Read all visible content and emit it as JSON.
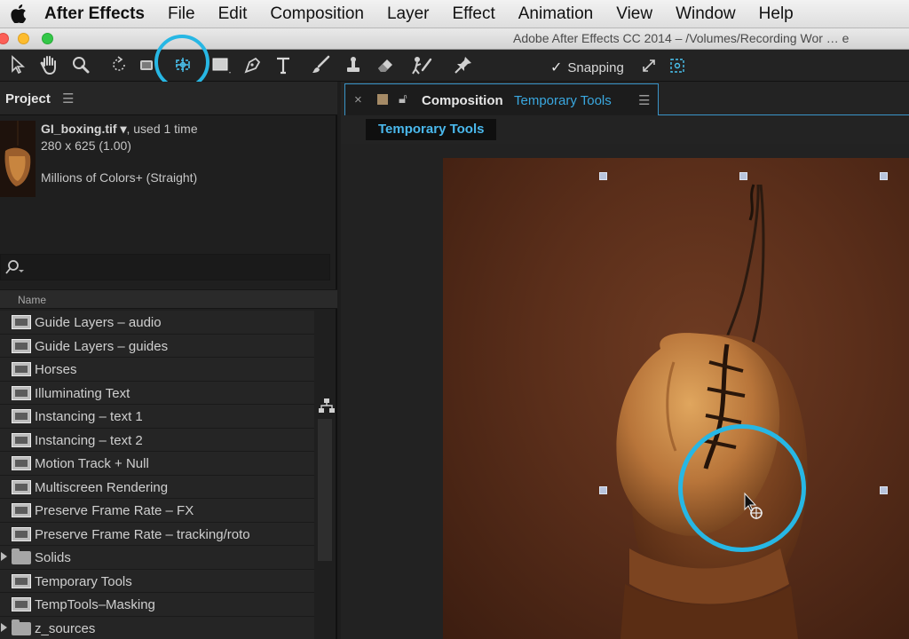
{
  "menubar": {
    "apple_icon": "apple-logo-icon",
    "app_name": "After Effects",
    "items": [
      "File",
      "Edit",
      "Composition",
      "Layer",
      "Effect",
      "Animation",
      "View",
      "Window",
      "Help"
    ]
  },
  "window": {
    "title": "Adobe After Effects CC 2014 – /Volumes/Recording Wor … e",
    "traffic_lights": [
      "#fc5f57",
      "#fdbc2e",
      "#33c748"
    ]
  },
  "tools": {
    "icons": [
      "selection-tool-icon",
      "hand-tool-icon",
      "zoom-tool-icon",
      "rotation-tool-icon",
      "camera-tool-icon",
      "pan-behind-tool-icon",
      "rectangle-tool-icon",
      "pen-tool-icon",
      "type-tool-icon",
      "brush-tool-icon",
      "clone-stamp-tool-icon",
      "eraser-tool-icon",
      "roto-brush-tool-icon",
      "puppet-pin-tool-icon"
    ],
    "snapping_label": "Snapping",
    "snapping_checked": true,
    "highlight_color": "#27b7e4"
  },
  "project": {
    "tab_label": "Project",
    "file_name": "GI_boxing.tif ▾",
    "file_usage": ", used 1 time",
    "dimensions": "280 x 625 (1.00)",
    "color_info": "Millions of Colors+ (Straight)",
    "column_name": "Name",
    "items": [
      {
        "label": "Guide Layers – audio",
        "type": "comp"
      },
      {
        "label": "Guide Layers – guides",
        "type": "comp"
      },
      {
        "label": "Horses",
        "type": "comp"
      },
      {
        "label": "Illuminating Text",
        "type": "comp"
      },
      {
        "label": "Instancing – text 1",
        "type": "comp"
      },
      {
        "label": "Instancing – text 2",
        "type": "comp"
      },
      {
        "label": "Motion Track + Null",
        "type": "comp"
      },
      {
        "label": "Multiscreen Rendering",
        "type": "comp"
      },
      {
        "label": "Preserve Frame Rate – FX",
        "type": "comp"
      },
      {
        "label": "Preserve Frame Rate – tracking/roto",
        "type": "comp"
      },
      {
        "label": "Solids",
        "type": "folder"
      },
      {
        "label": "Temporary Tools",
        "type": "comp"
      },
      {
        "label": "TempTools–Masking",
        "type": "comp"
      },
      {
        "label": "z_sources",
        "type": "folder"
      }
    ]
  },
  "composition": {
    "tab_prefix": "Composition",
    "tab_name": "Temporary Tools",
    "breadcrumb": "Temporary Tools",
    "accent": "#3aa8e0"
  }
}
